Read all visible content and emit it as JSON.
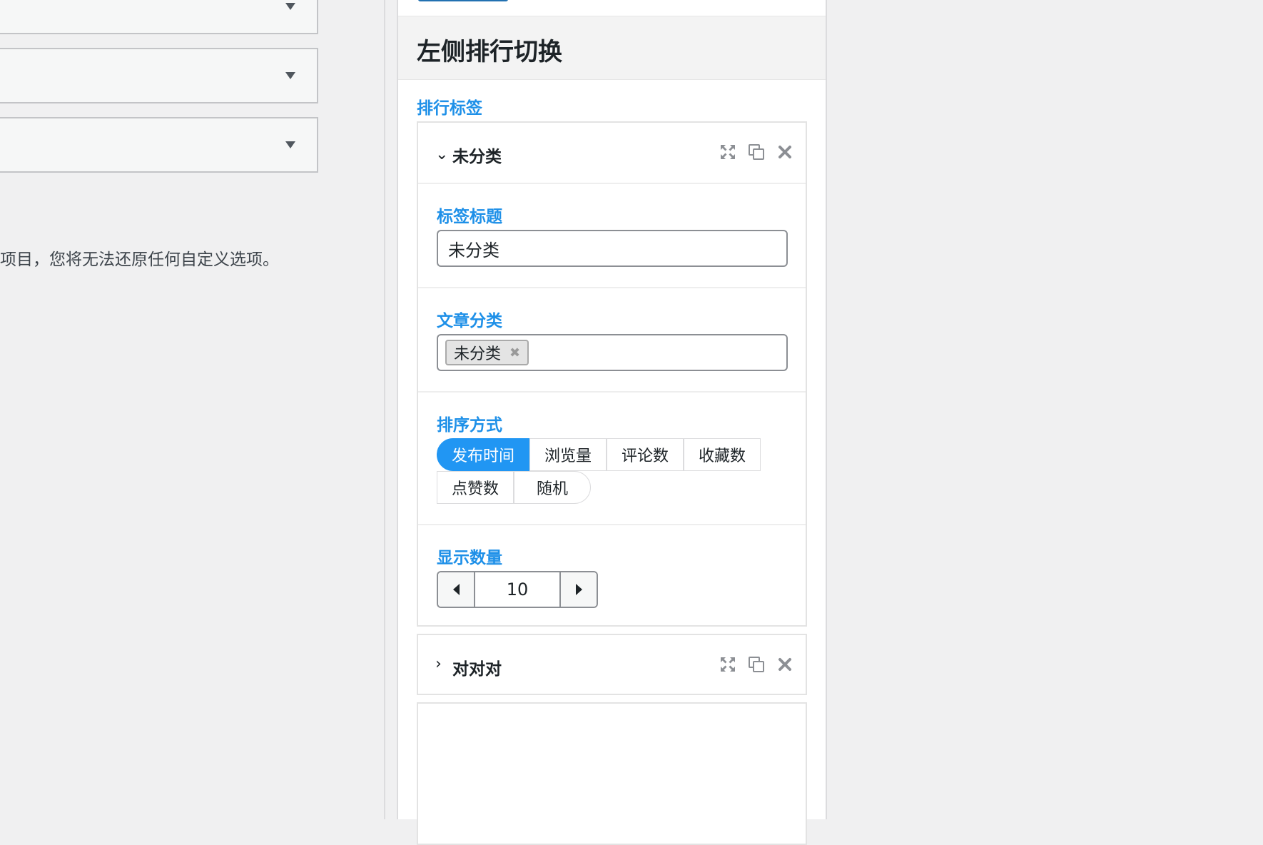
{
  "background": {
    "notice": "项目，您将无法还原任何自定义选项。"
  },
  "panel": {
    "title": "左侧排行切换",
    "section_label": "排行标签",
    "items": [
      {
        "title": "未分类",
        "expanded": true,
        "fields": {
          "tab_title_label": "标签标题",
          "tab_title_value": "未分类",
          "category_label": "文章分类",
          "category_tags": [
            "未分类"
          ],
          "sort_label": "排序方式",
          "sort_options": [
            "发布时间",
            "浏览量",
            "评论数",
            "收藏数",
            "点赞数",
            "随机"
          ],
          "sort_selected": "发布时间",
          "count_label": "显示数量",
          "count_value": "10"
        }
      },
      {
        "title": "对对对",
        "expanded": false
      }
    ]
  },
  "icons": {
    "expand": "expand-icon",
    "duplicate": "duplicate-icon",
    "remove": "close-icon"
  },
  "colors": {
    "accent": "#1e90e8",
    "active_button": "#2196f3"
  }
}
